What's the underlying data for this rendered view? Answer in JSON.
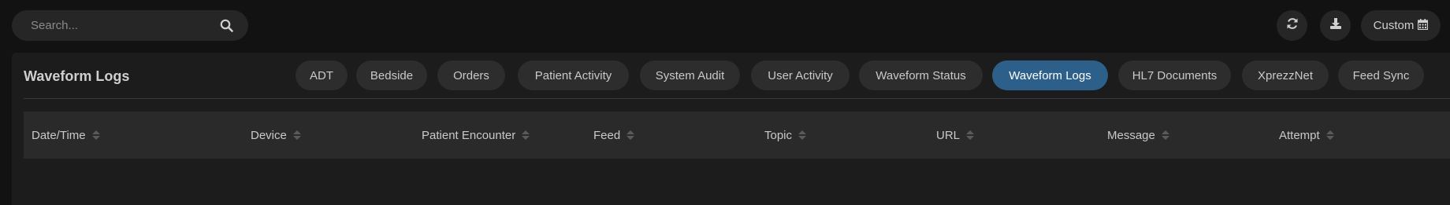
{
  "search": {
    "placeholder": "Search...",
    "value": ""
  },
  "toolbar": {
    "refresh_icon": "refresh-icon",
    "download_icon": "download-icon",
    "custom_label": "Custom",
    "calendar_icon": "calendar-icon"
  },
  "panel": {
    "title": "Waveform Logs",
    "tabs": [
      {
        "label": "ADT"
      },
      {
        "label": "Bedside"
      },
      {
        "label": "Orders"
      },
      {
        "label": "Patient Activity"
      },
      {
        "label": "System Audit"
      },
      {
        "label": "User Activity"
      },
      {
        "label": "Waveform Status"
      },
      {
        "label": "Waveform Logs",
        "active": true
      },
      {
        "label": "HL7 Documents"
      },
      {
        "label": "XprezzNet"
      },
      {
        "label": "Feed Sync"
      }
    ]
  },
  "table": {
    "columns": [
      "Date/Time",
      "Device",
      "Patient Encounter",
      "Feed",
      "Topic",
      "URL",
      "Message",
      "Attempt"
    ],
    "rows": []
  },
  "colors": {
    "background": "#121212",
    "panel": "#1c1c1c",
    "control": "#262626",
    "tab": "#2d2d2d",
    "active_tab": "#2d5f8b",
    "header_row": "#2a2a2a"
  }
}
